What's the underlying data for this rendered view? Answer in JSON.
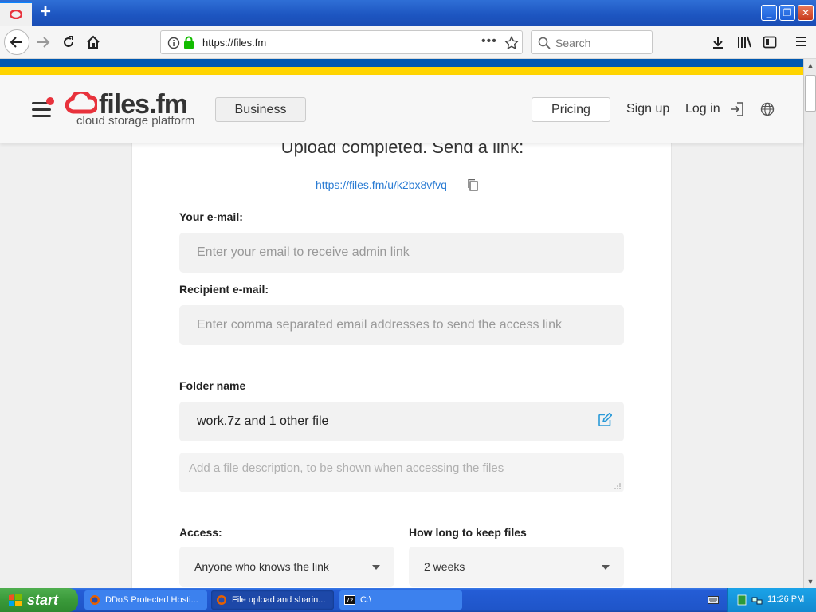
{
  "browser": {
    "url": "https://files.fm",
    "search_placeholder": "Search"
  },
  "header": {
    "logo_text": "files.fm",
    "logo_tagline": "cloud storage platform",
    "business_label": "Business",
    "pricing_label": "Pricing",
    "signup_label": "Sign up",
    "login_label": "Log in"
  },
  "main": {
    "title": "Upload completed. Send a link:",
    "share_link": "https://files.fm/u/k2bx8vfvq",
    "your_email_label": "Your e-mail:",
    "your_email_placeholder": "Enter your email to receive admin link",
    "recipient_label": "Recipient e-mail:",
    "recipient_placeholder": "Enter comma separated email addresses to send the access link",
    "folder_label": "Folder name",
    "folder_value": "work.7z and 1 other file",
    "description_placeholder": "Add a file description, to be shown when accessing the files",
    "access_label": "Access:",
    "access_value": "Anyone who knows the link",
    "keep_label": "How long to keep files",
    "keep_value": "2 weeks"
  },
  "taskbar": {
    "start_label": "start",
    "items": [
      {
        "label": "DDoS Protected Hosti..."
      },
      {
        "label": "File upload and sharin..."
      },
      {
        "label": "C:\\"
      }
    ],
    "clock": "11:26 PM"
  },
  "colors": {
    "link": "#2b7cd3",
    "brand_red": "#e8323c",
    "stripe_blue": "#0058b0",
    "stripe_yellow": "#ffd400"
  }
}
